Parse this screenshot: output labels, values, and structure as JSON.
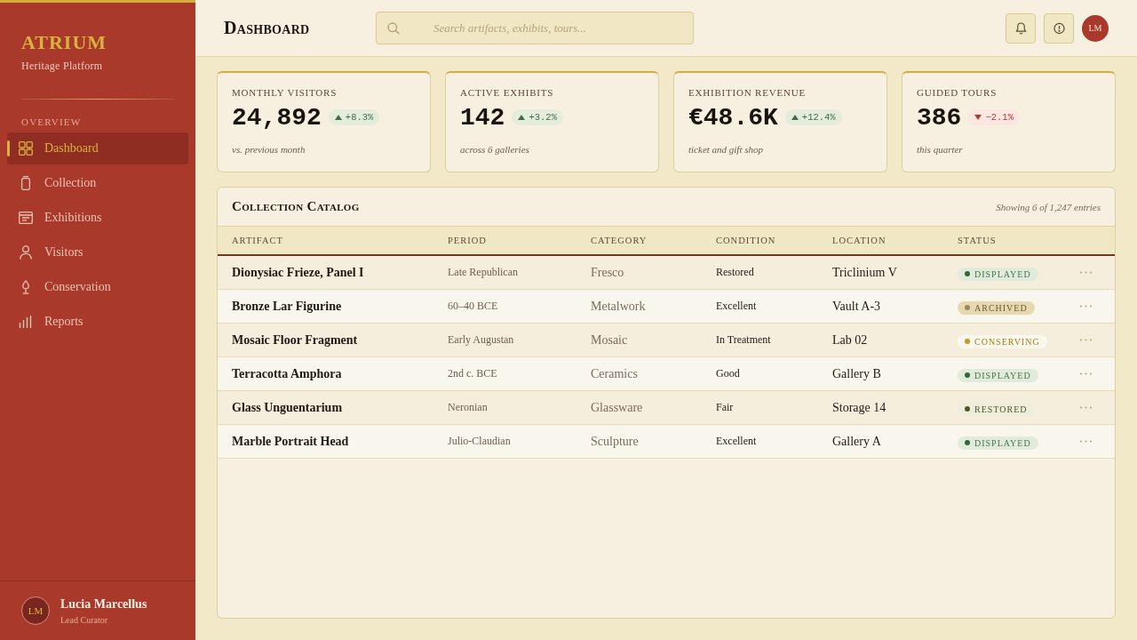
{
  "sidebar": {
    "brand": "ATRIUM",
    "tagline": "Heritage Platform",
    "section": "OVERVIEW",
    "items": [
      {
        "label": "Dashboard",
        "selected": true
      },
      {
        "label": "Collection",
        "selected": false
      },
      {
        "label": "Exhibitions",
        "selected": false
      },
      {
        "label": "Visitors",
        "selected": false
      },
      {
        "label": "Conservation",
        "selected": false
      },
      {
        "label": "Reports",
        "selected": false
      }
    ],
    "user": {
      "initials": "LM",
      "name": "Lucia Marcellus",
      "role": "Lead Curator"
    }
  },
  "header": {
    "title": "Dashboard",
    "search": {
      "placeholder": "Search artifacts, exhibits, tours..."
    },
    "avatar": "LM"
  },
  "stats": [
    {
      "label": "MONTHLY VISITORS",
      "value": "24,892",
      "change": "+8.3%",
      "kind": "up",
      "note": "vs. previous month"
    },
    {
      "label": "ACTIVE EXHIBITS",
      "value": "142",
      "change": "+3.2%",
      "kind": "up",
      "note": "across 6 galleries"
    },
    {
      "label": "EXHIBITION REVENUE",
      "value": "€48.6K",
      "change": "+12.4%",
      "kind": "up",
      "note": "ticket and gift shop"
    },
    {
      "label": "GUIDED TOURS",
      "value": "386",
      "change": "−2.1%",
      "kind": "down",
      "note": "this quarter"
    }
  ],
  "catalog": {
    "title": "Collection Catalog",
    "summary": "Showing 6 of 1,247 entries",
    "columns": [
      "ARTIFACT",
      "PERIOD",
      "CATEGORY",
      "CONDITION",
      "LOCATION",
      "STATUS"
    ],
    "rows": [
      {
        "artifact": "Dionysiac Frieze, Panel I",
        "period": "Late Republican",
        "category": "Fresco",
        "condition": "Restored",
        "location": "Triclinium V",
        "status": {
          "label": "DISPLAYED",
          "kind": "displayed"
        }
      },
      {
        "artifact": "Bronze Lar Figurine",
        "period": "60–40 BCE",
        "category": "Metalwork",
        "condition": "Excellent",
        "location": "Vault A-3",
        "status": {
          "label": "ARCHIVED",
          "kind": "archived"
        }
      },
      {
        "artifact": "Mosaic Floor Fragment",
        "period": "Early Augustan",
        "category": "Mosaic",
        "condition": "In Treatment",
        "location": "Lab 02",
        "status": {
          "label": "CONSERVING",
          "kind": "conserving"
        }
      },
      {
        "artifact": "Terracotta Amphora",
        "period": "2nd c. BCE",
        "category": "Ceramics",
        "condition": "Good",
        "location": "Gallery B",
        "status": {
          "label": "DISPLAYED",
          "kind": "displayed"
        }
      },
      {
        "artifact": "Glass Unguentarium",
        "period": "Neronian",
        "category": "Glassware",
        "condition": "Fair",
        "location": "Storage 14",
        "status": {
          "label": "RESTORED",
          "kind": "restored"
        }
      },
      {
        "artifact": "Marble Portrait Head",
        "period": "Julio-Claudian",
        "category": "Sculpture",
        "condition": "Excellent",
        "location": "Gallery A",
        "status": {
          "label": "DISPLAYED",
          "kind": "displayed"
        }
      }
    ]
  }
}
